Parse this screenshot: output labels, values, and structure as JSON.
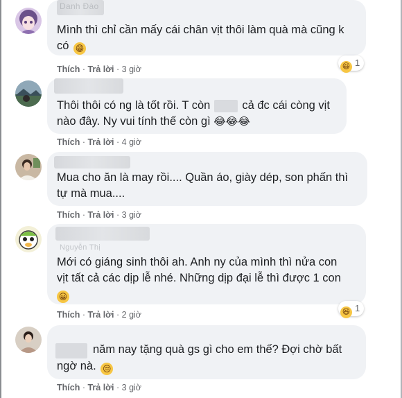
{
  "comments": [
    {
      "author_partial": "Danh Đào",
      "text_line1": "Mình thì chỉ cần mấy cái chân vịt thôi làm quà mà cũng k",
      "text_line2": "có",
      "emoji": "😁",
      "like_label": "Thích",
      "reply_label": "Trả lời",
      "time": "3 giờ",
      "reaction_icon": "😆",
      "reaction_count": "1"
    },
    {
      "text_line1a": "Thôi thôi có ng là tốt rồi. T còn",
      "text_line1b": "cả đc cái còng vịt",
      "text_line2": "nào đây. Ny vui tính thế còn gì",
      "emoji": "😂😂😂",
      "like_label": "Thích",
      "reply_label": "Trả lời",
      "time": "4 giờ"
    },
    {
      "text_line1": "Mua cho ăn là may rồi.... Quần áo, giày dép, son phấn thì",
      "text_line2": "tự mà mua....",
      "like_label": "Thích",
      "reply_label": "Trả lời",
      "time": "3 giờ"
    },
    {
      "author_partial": "Nguyễn Thị",
      "text_line1": "Mới có giáng sinh thôi ah. Anh ny của mình thì nửa con",
      "text_line2": "vịt tất cả các dịp lễ nhé. Những dịp đại lễ thì được 1 con",
      "emoji": "😀",
      "like_label": "Thích",
      "reply_label": "Trả lời",
      "time": "2 giờ",
      "reaction_icon": "😆",
      "reaction_count": "1"
    },
    {
      "text_line1": "năm nay tặng quà gs gì cho em thế? Đợi chờ bất",
      "text_line2": "ngờ nà.",
      "emoji": "😔",
      "like_label": "Thích",
      "reply_label": "Trả lời",
      "time": "3 giờ"
    }
  ],
  "colors": {
    "bubble": "#f0f2f5",
    "meta_text": "#65676b",
    "body_text": "#1c1e21"
  }
}
